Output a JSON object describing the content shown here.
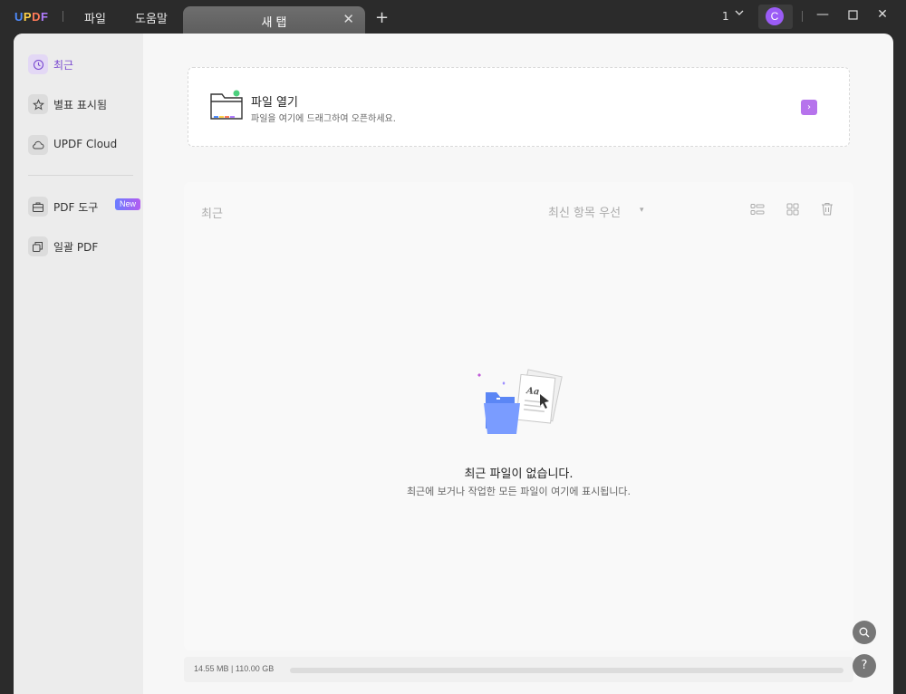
{
  "titlebar": {
    "logo": {
      "u": "U",
      "p": "P",
      "d": "D",
      "f": "F"
    },
    "menu": [
      "파일",
      "도움말"
    ],
    "tab_title": "새 탭",
    "tab_close": "✕",
    "tab_add": "+",
    "page_number": "1",
    "avatar_letter": "C",
    "window_controls": {
      "minimize": "—",
      "maximize": "☐",
      "close": "✕"
    }
  },
  "sidebar": {
    "items": [
      {
        "label": "최근",
        "icon": "clock-icon",
        "active": true
      },
      {
        "label": "별표 표시됨",
        "icon": "star-icon"
      },
      {
        "label": "UPDF Cloud",
        "icon": "cloud-icon"
      },
      {
        "label": "PDF 도구",
        "icon": "toolbox-icon",
        "badge": "New"
      },
      {
        "label": "일괄 PDF",
        "icon": "batch-icon"
      }
    ]
  },
  "open_file": {
    "title": "파일 열기",
    "subtitle": "파일을 여기에 드래그하여 오픈하세요.",
    "arrow": "›"
  },
  "recent": {
    "heading": "최근",
    "sort_label": "최신 항목 우선",
    "sort_caret": "▾",
    "empty_title": "최근 파일이 없습니다.",
    "empty_subtitle": "최근에 보거나 작업한 모든 파일이 여기에 표시됩니다."
  },
  "storage": {
    "text": "14.55 MB | 110.00 GB",
    "used_fraction": 0.0001
  },
  "floating": {
    "search": "⌕",
    "help": "?"
  },
  "colors": {
    "accent": "#7a4ad0",
    "arrow_button": "#b673ec",
    "badge_start": "#6a7dff",
    "badge_end": "#b35cf0"
  }
}
